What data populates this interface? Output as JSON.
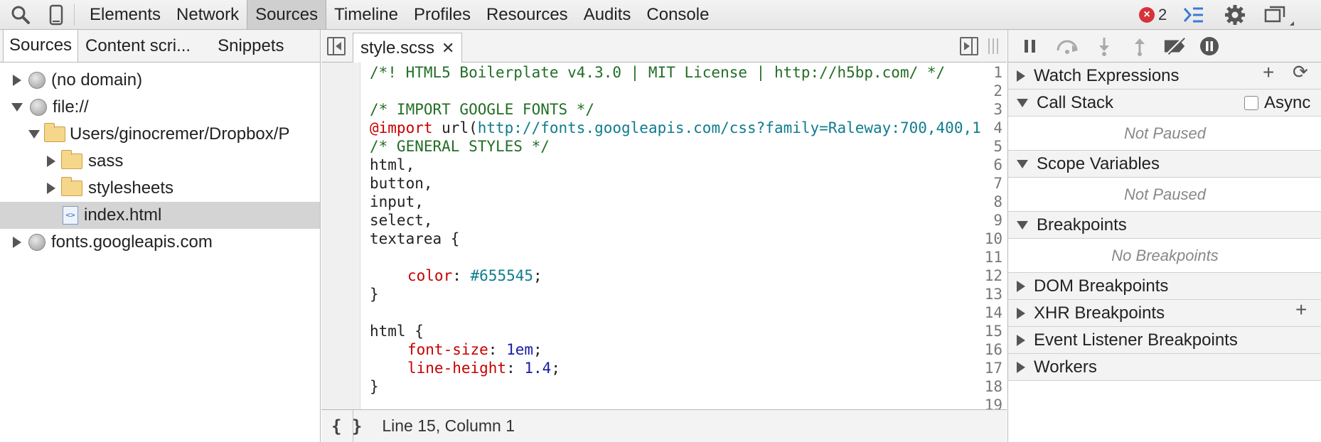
{
  "toolbar": {
    "search_icon": "search-icon",
    "device_icon": "device-mode-icon",
    "tabs": [
      {
        "label": "Elements"
      },
      {
        "label": "Network"
      },
      {
        "label": "Sources"
      },
      {
        "label": "Timeline"
      },
      {
        "label": "Profiles"
      },
      {
        "label": "Resources"
      },
      {
        "label": "Audits"
      },
      {
        "label": "Console"
      }
    ],
    "active_tab": "Sources",
    "error_count": "2",
    "accent_color": "#3a7ad9",
    "error_color": "#d6323a"
  },
  "navigator": {
    "tabs": [
      {
        "label": "Sources"
      },
      {
        "label": "Content scri..."
      },
      {
        "label": "Snippets"
      }
    ],
    "tree": [
      {
        "label": "(no domain)"
      },
      {
        "label": "file://"
      },
      {
        "label": "Users/ginocremer/Dropbox/P"
      },
      {
        "label": "sass"
      },
      {
        "label": "stylesheets"
      },
      {
        "label": "index.html"
      },
      {
        "label": "fonts.googleapis.com"
      }
    ]
  },
  "editor": {
    "tab_label": "style.scss",
    "line_numbers": [
      "1",
      "2",
      "3",
      "4",
      "5",
      "6",
      "7",
      "8",
      "9",
      "10",
      "11",
      "12",
      "13",
      "14",
      "15",
      "16",
      "17",
      "18",
      "19"
    ],
    "code": {
      "l1": "/*! HTML5 Boilerplate v4.3.0 | MIT License | http://h5bp.com/ */",
      "l3": "/* IMPORT GOOGLE FONTS */",
      "l4_at": "@import",
      "l4_fn": " url(",
      "l4_url": "http://fonts.googleapis.com/css?family=Raleway:700,400,1",
      "l5": "/* GENERAL STYLES */",
      "l6": "html,",
      "l7": "button,",
      "l8": "input,",
      "l9": "select,",
      "l10": "textarea {",
      "l12_prop": "color",
      "l12_colon": ": ",
      "l12_val": "#655545",
      "l12_end": ";",
      "l13": "}",
      "l15": "html {",
      "l16_prop": "font-size",
      "l16_colon": ": ",
      "l16_val": "1em",
      "l16_end": ";",
      "l17_prop": "line-height",
      "l17_colon": ": ",
      "l17_val": "1.4",
      "l17_end": ";",
      "l18": "}"
    },
    "format_button": "{ }",
    "status": "Line 15, Column 1"
  },
  "debugger": {
    "watch_expressions": "Watch Expressions",
    "call_stack": "Call Stack",
    "async_label": "Async",
    "call_stack_body": "Not Paused",
    "scope_variables": "Scope Variables",
    "scope_body": "Not Paused",
    "breakpoints": "Breakpoints",
    "breakpoints_body": "No Breakpoints",
    "dom_breakpoints": "DOM Breakpoints",
    "xhr_breakpoints": "XHR Breakpoints",
    "event_listener_breakpoints": "Event Listener Breakpoints",
    "workers": "Workers"
  }
}
